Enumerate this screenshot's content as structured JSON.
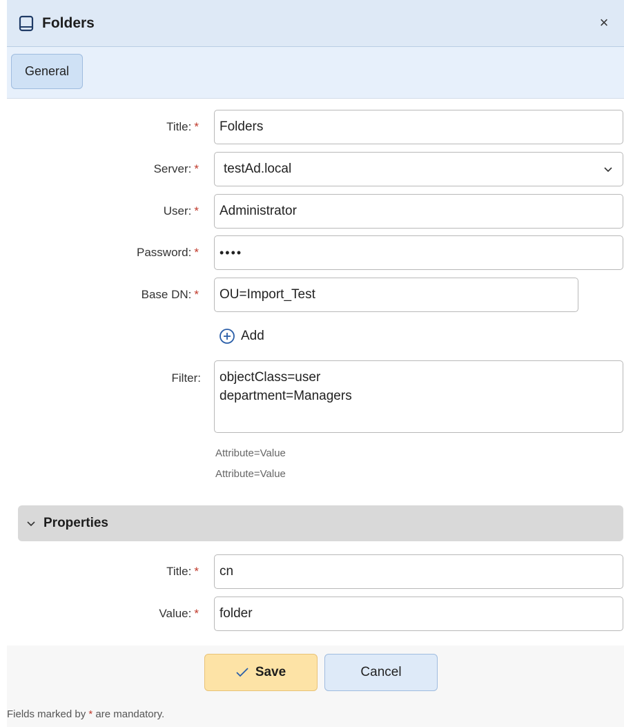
{
  "dialog": {
    "title": "Folders",
    "close_glyph": "×",
    "icon": "book-icon"
  },
  "tabs": [
    {
      "label": "General",
      "active": true
    }
  ],
  "form": {
    "title_label": "Title:",
    "title_value": "Folders",
    "server_label": "Server:",
    "server_value": "testAd.local",
    "user_label": "User:",
    "user_value": "Administrator",
    "password_label": "Password:",
    "password_value": "••••",
    "base_dn_label": "Base DN:",
    "base_dn_value": "OU=Import_Test",
    "add_label": "Add",
    "filter_label": "Filter:",
    "filter_lines": [
      "objectClass=user",
      "department=Managers"
    ],
    "filter_hint_lines": [
      "Attribute=Value",
      "Attribute=Value"
    ],
    "required_mark": "*"
  },
  "properties": {
    "section_title": "Properties",
    "expanded": true,
    "title_label": "Title:",
    "title_value": "cn",
    "value_label": "Value:",
    "value_value": "folder"
  },
  "actions": {
    "save_label": "Save",
    "cancel_label": "Cancel"
  },
  "footer": {
    "note_prefix": "Fields marked by",
    "note_mark": "*",
    "note_suffix": "are mandatory."
  },
  "colors": {
    "header_bg": "#dee9f6",
    "tab_bg": "#cfe1f5",
    "save_bg": "#fde3a6",
    "cancel_bg": "#deeaf8",
    "required": "#c0392b",
    "section_bg": "#d9d9d9"
  }
}
